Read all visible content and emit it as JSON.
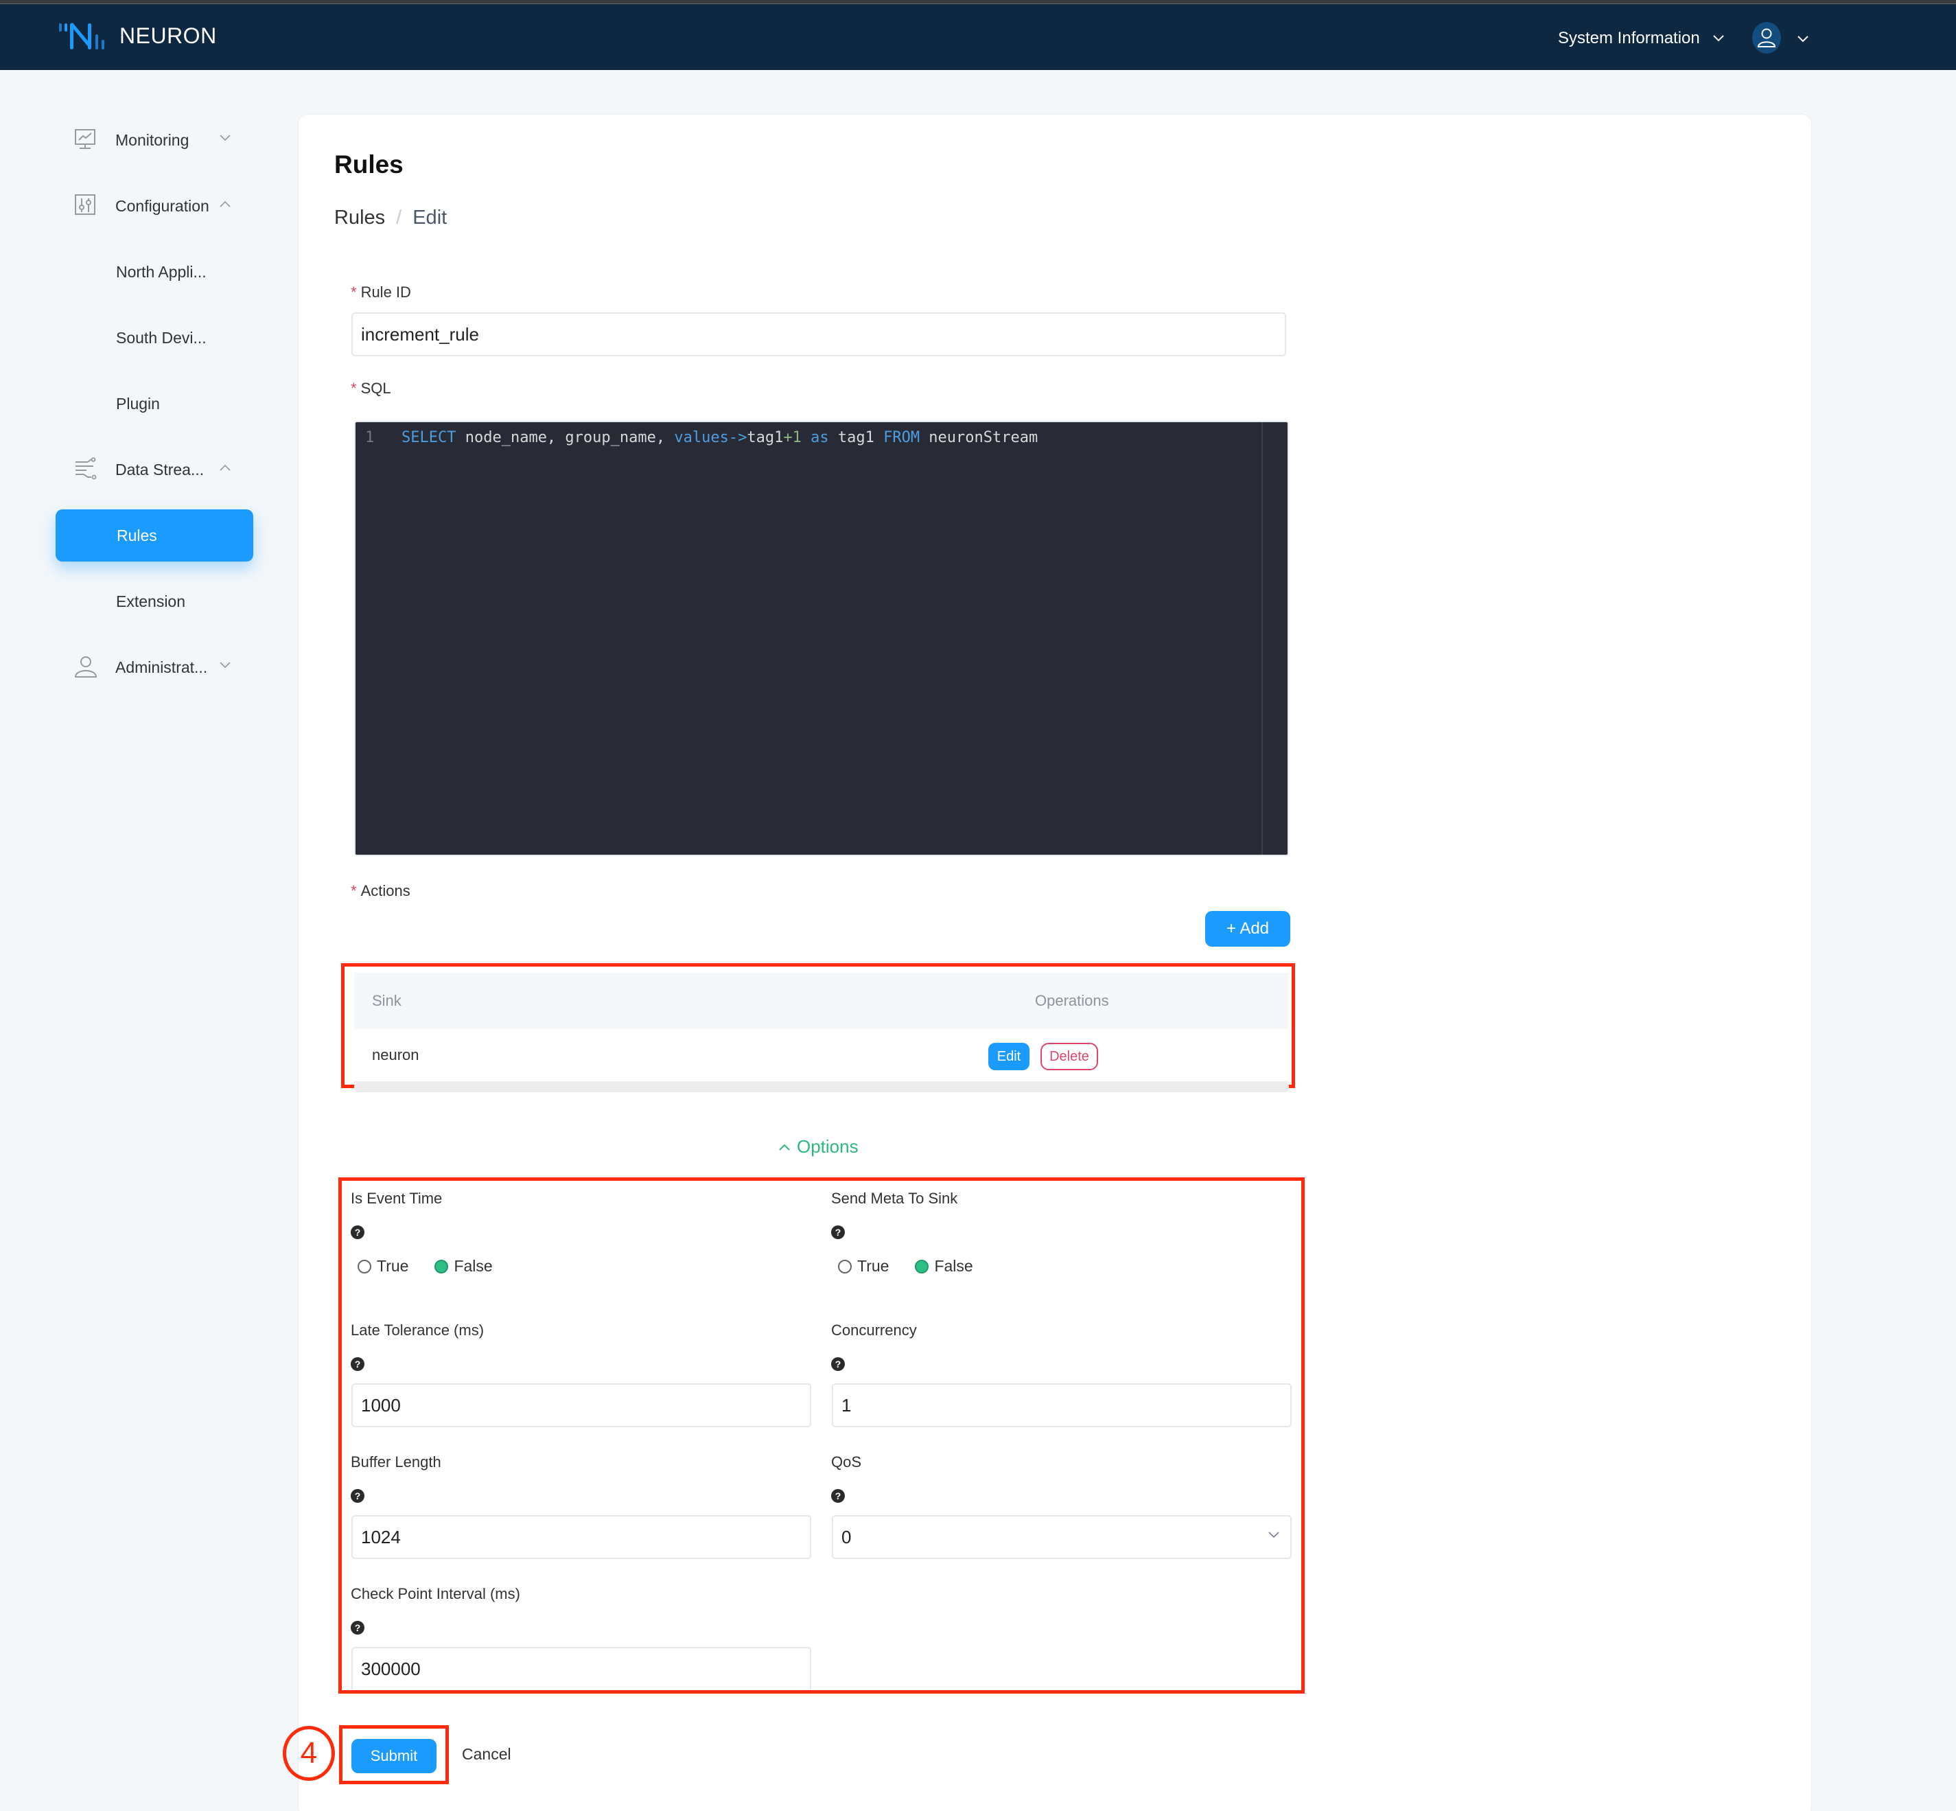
{
  "app": {
    "brand": "NEURON",
    "system_info": "System Information"
  },
  "sidebar": {
    "items": [
      {
        "label": "Monitoring",
        "icon": "monitor-chart-icon",
        "expanded": false
      },
      {
        "label": "Configuration",
        "icon": "sliders-icon",
        "expanded": true
      },
      {
        "label": "North Appli...",
        "sub": true
      },
      {
        "label": "South Devi...",
        "sub": true
      },
      {
        "label": "Plugin",
        "sub": true
      },
      {
        "label": "Data Strea...",
        "icon": "data-stream-icon",
        "expanded": true
      },
      {
        "label": "Rules",
        "sub": true,
        "active": true
      },
      {
        "label": "Extension",
        "sub": true
      },
      {
        "label": "Administrat...",
        "icon": "user-icon",
        "expanded": false
      }
    ]
  },
  "page": {
    "title": "Rules",
    "breadcrumb": [
      "Rules",
      "Edit"
    ]
  },
  "form": {
    "rule_id": {
      "label": "Rule ID",
      "required": true,
      "value": "increment_rule"
    },
    "sql": {
      "label": "SQL",
      "required": true,
      "line_number": "1",
      "tokens": [
        {
          "t": "SELECT",
          "c": "kw"
        },
        {
          "t": " node_name, group_name, ",
          "c": ""
        },
        {
          "t": "values",
          "c": "kw"
        },
        {
          "t": "->",
          "c": "kw"
        },
        {
          "t": "tag1",
          "c": ""
        },
        {
          "t": "+1",
          "c": "op"
        },
        {
          "t": " ",
          "c": ""
        },
        {
          "t": "as",
          "c": "kw"
        },
        {
          "t": " tag1 ",
          "c": ""
        },
        {
          "t": "FROM",
          "c": "kw"
        },
        {
          "t": " neuronStream",
          "c": ""
        }
      ]
    },
    "actions": {
      "label": "Actions",
      "required": true,
      "add_label": "+ Add",
      "columns": [
        "Sink",
        "Operations"
      ],
      "rows": [
        {
          "sink": "neuron",
          "edit_label": "Edit",
          "delete_label": "Delete"
        }
      ]
    },
    "options": {
      "toggle_label": "Options",
      "is_event_time": {
        "label": "Is Event Time",
        "options": [
          "True",
          "False"
        ],
        "selected": "False"
      },
      "send_meta_to_sink": {
        "label": "Send Meta To Sink",
        "options": [
          "True",
          "False"
        ],
        "selected": "False"
      },
      "late_tolerance": {
        "label": "Late Tolerance (ms)",
        "value": "1000"
      },
      "concurrency": {
        "label": "Concurrency",
        "value": "1"
      },
      "buffer_length": {
        "label": "Buffer Length",
        "value": "1024"
      },
      "qos": {
        "label": "QoS",
        "value": "0"
      },
      "check_point_interval": {
        "label": "Check Point Interval (ms)",
        "value": "300000"
      },
      "help_glyph": "?"
    },
    "submit_label": "Submit",
    "cancel_label": "Cancel"
  },
  "annotation": {
    "step_number": "4"
  },
  "colors": {
    "navbar": "#0d2840",
    "primary": "#1c9bff",
    "success": "#2db87d",
    "danger": "#e0456b",
    "highlight": "#ff2b0a"
  }
}
